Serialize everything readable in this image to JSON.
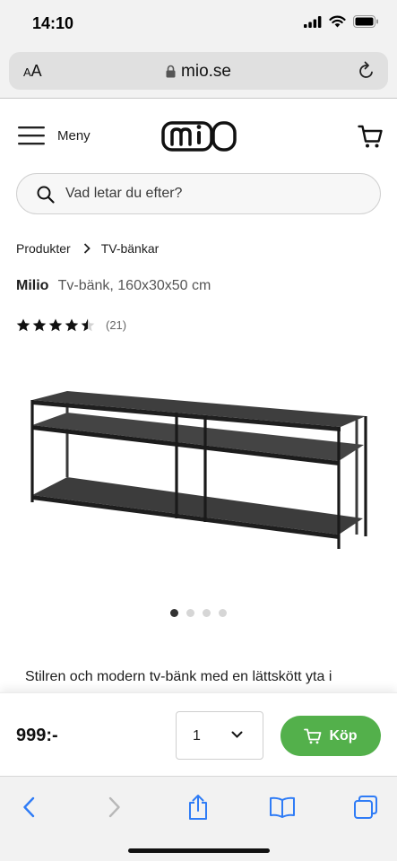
{
  "status_bar": {
    "time": "14:10"
  },
  "browser": {
    "text_size_label": "AA",
    "url": "mio.se"
  },
  "header": {
    "menu_label": "Meny",
    "logo_text": "MIO"
  },
  "search": {
    "placeholder": "Vad letar du efter?"
  },
  "breadcrumb": {
    "items": [
      "Produkter",
      "TV-bänkar"
    ]
  },
  "product": {
    "brand": "Milio",
    "description": "Tv-bänk, 160x30x50 cm",
    "rating": 4.5,
    "review_count": "(21)",
    "image_count": 4,
    "active_image": 1,
    "intro_text": "Stilren och modern tv-bänk med en lättskött yta i"
  },
  "buy_bar": {
    "price": "999:-",
    "quantity": "1",
    "buy_label": "Köp"
  },
  "colors": {
    "accent_green": "#53b04b",
    "text": "#1d1d1d",
    "chrome_bg": "#f2f2f2",
    "ios_blue": "#2f7cf6"
  }
}
